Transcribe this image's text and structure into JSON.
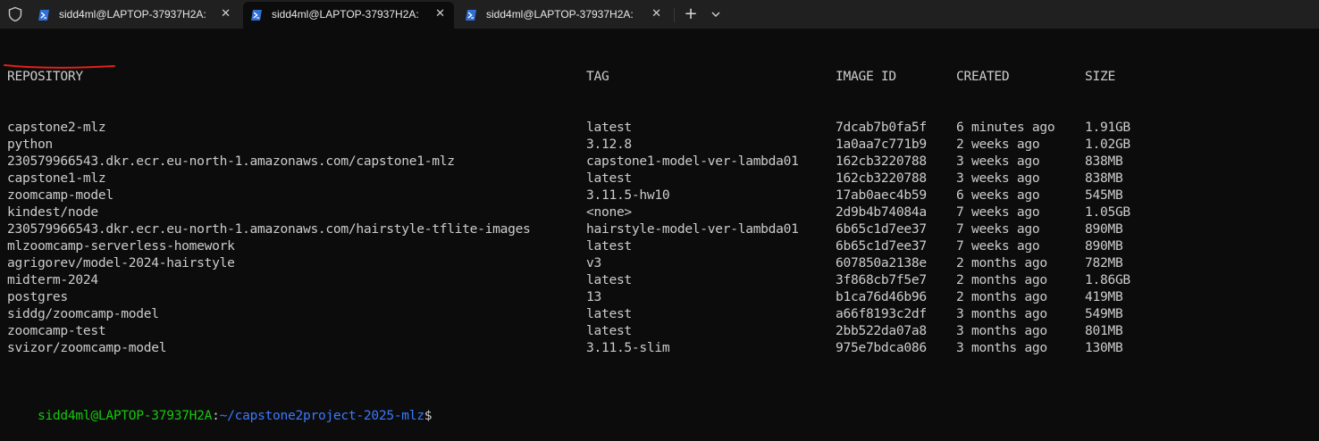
{
  "tabs": [
    {
      "label": "sidd4ml@LAPTOP-37937H2A:",
      "active": false
    },
    {
      "label": "sidd4ml@LAPTOP-37937H2A:",
      "active": true
    },
    {
      "label": "sidd4ml@LAPTOP-37937H2A:",
      "active": false
    }
  ],
  "tabbar": {
    "new_tab": "+",
    "close_glyph": "✕"
  },
  "table": {
    "headers": {
      "repository": "REPOSITORY",
      "tag": "TAG",
      "image_id": "IMAGE ID",
      "created": "CREATED",
      "size": "SIZE"
    },
    "rows": [
      {
        "repository": "capstone2-mlz",
        "tag": "latest",
        "image_id": "7dcab7b0fa5f",
        "created": "6 minutes ago",
        "size": "1.91GB"
      },
      {
        "repository": "python",
        "tag": "3.12.8",
        "image_id": "1a0aa7c771b9",
        "created": "2 weeks ago",
        "size": "1.02GB"
      },
      {
        "repository": "230579966543.dkr.ecr.eu-north-1.amazonaws.com/capstone1-mlz",
        "tag": "capstone1-model-ver-lambda01",
        "image_id": "162cb3220788",
        "created": "3 weeks ago",
        "size": "838MB"
      },
      {
        "repository": "capstone1-mlz",
        "tag": "latest",
        "image_id": "162cb3220788",
        "created": "3 weeks ago",
        "size": "838MB"
      },
      {
        "repository": "zoomcamp-model",
        "tag": "3.11.5-hw10",
        "image_id": "17ab0aec4b59",
        "created": "6 weeks ago",
        "size": "545MB"
      },
      {
        "repository": "kindest/node",
        "tag": "<none>",
        "image_id": "2d9b4b74084a",
        "created": "7 weeks ago",
        "size": "1.05GB"
      },
      {
        "repository": "230579966543.dkr.ecr.eu-north-1.amazonaws.com/hairstyle-tflite-images",
        "tag": "hairstyle-model-ver-lambda01",
        "image_id": "6b65c1d7ee37",
        "created": "7 weeks ago",
        "size": "890MB"
      },
      {
        "repository": "mlzoomcamp-serverless-homework",
        "tag": "latest",
        "image_id": "6b65c1d7ee37",
        "created": "7 weeks ago",
        "size": "890MB"
      },
      {
        "repository": "agrigorev/model-2024-hairstyle",
        "tag": "v3",
        "image_id": "607850a2138e",
        "created": "2 months ago",
        "size": "782MB"
      },
      {
        "repository": "midterm-2024",
        "tag": "latest",
        "image_id": "3f868cb7f5e7",
        "created": "2 months ago",
        "size": "1.86GB"
      },
      {
        "repository": "postgres",
        "tag": "13",
        "image_id": "b1ca76d46b96",
        "created": "2 months ago",
        "size": "419MB"
      },
      {
        "repository": "siddg/zoomcamp-model",
        "tag": "latest",
        "image_id": "a66f8193c2df",
        "created": "3 months ago",
        "size": "549MB"
      },
      {
        "repository": "zoomcamp-test",
        "tag": "latest",
        "image_id": "2bb522da07a8",
        "created": "3 months ago",
        "size": "801MB"
      },
      {
        "repository": "svizor/zoomcamp-model",
        "tag": "3.11.5-slim",
        "image_id": "975e7bdca086",
        "created": "3 months ago",
        "size": "130MB"
      }
    ]
  },
  "prompt": {
    "user_host": "sidd4ml@LAPTOP-37937H2A",
    "colon": ":",
    "path": "~/capstone2project-2025-mlz",
    "symbol": "$"
  },
  "colors": {
    "background": "#0c0c0c",
    "text": "#cccccc",
    "prompt_user": "#16c60c",
    "prompt_path": "#3b78ff",
    "annotation": "#e0201b"
  }
}
